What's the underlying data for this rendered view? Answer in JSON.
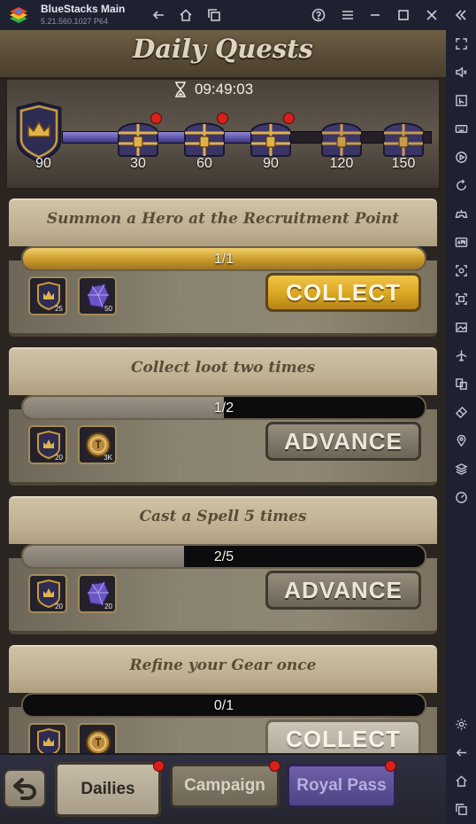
{
  "window": {
    "app_title": "BlueStacks Main",
    "app_version": "5.21.560.1027  P64"
  },
  "header": {
    "title": "Daily Quests",
    "timer": "09:49:03",
    "player_points": "90",
    "progress_fraction": 0.6,
    "milestones": [
      {
        "value": "30",
        "has_notification": true
      },
      {
        "value": "60",
        "has_notification": true
      },
      {
        "value": "90",
        "has_notification": true
      },
      {
        "value": "120",
        "has_notification": false
      },
      {
        "value": "150",
        "has_notification": false
      }
    ]
  },
  "quests": [
    {
      "title": "Summon a Hero at the Recruitment Point",
      "progress_text": "1/1",
      "progress_fraction": 1.0,
      "rewards": [
        {
          "icon": "shield-crest-icon",
          "qty": "25"
        },
        {
          "icon": "purple-crystal-icon",
          "qty": "50"
        }
      ],
      "button": "COLLECT",
      "button_state": "collect"
    },
    {
      "title": "Collect loot two times",
      "progress_text": "1/2",
      "progress_fraction": 0.5,
      "rewards": [
        {
          "icon": "shield-crest-icon",
          "qty": "20"
        },
        {
          "icon": "gold-coin-icon",
          "qty": "3K"
        }
      ],
      "button": "ADVANCE",
      "button_state": "advance"
    },
    {
      "title": "Cast a Spell 5 times",
      "progress_text": "2/5",
      "progress_fraction": 0.4,
      "rewards": [
        {
          "icon": "shield-crest-icon",
          "qty": "20"
        },
        {
          "icon": "purple-crystal-icon",
          "qty": "20"
        }
      ],
      "button": "ADVANCE",
      "button_state": "advance"
    },
    {
      "title": "Refine your Gear once",
      "progress_text": "0/1",
      "progress_fraction": 0.0,
      "rewards": [
        {
          "icon": "shield-crest-icon",
          "qty": ""
        },
        {
          "icon": "gold-coin-icon",
          "qty": ""
        }
      ],
      "button": "COLLECT",
      "button_state": "disabled"
    }
  ],
  "tabs": [
    {
      "label": "Dailies",
      "active": true,
      "has_notification": true
    },
    {
      "label": "Campaign",
      "active": false,
      "has_notification": true
    },
    {
      "label": "Royal Pass",
      "active": false,
      "has_notification": true
    }
  ],
  "colors": {
    "accent_gold": "#d9a61f",
    "notification_red": "#d9201d",
    "progress_purple": "#6f68c4"
  }
}
